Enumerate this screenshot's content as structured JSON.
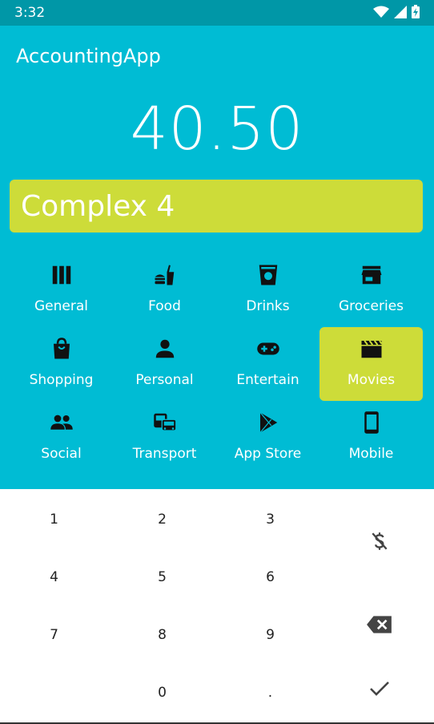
{
  "status": {
    "time": "3:32"
  },
  "app": {
    "title": "AccountingApp"
  },
  "amount": "40.50",
  "description": "Complex 4",
  "categories": [
    {
      "label": "General",
      "icon": "columns-icon",
      "selected": false
    },
    {
      "label": "Food",
      "icon": "fastfood-icon",
      "selected": false
    },
    {
      "label": "Drinks",
      "icon": "drink-cup-icon",
      "selected": false
    },
    {
      "label": "Groceries",
      "icon": "store-icon",
      "selected": false
    },
    {
      "label": "Shopping",
      "icon": "shopping-bag-icon",
      "selected": false
    },
    {
      "label": "Personal",
      "icon": "person-icon",
      "selected": false
    },
    {
      "label": "Entertain",
      "icon": "gamepad-icon",
      "selected": false
    },
    {
      "label": "Movies",
      "icon": "clapperboard-icon",
      "selected": true
    },
    {
      "label": "Social",
      "icon": "people-icon",
      "selected": false
    },
    {
      "label": "Transport",
      "icon": "transport-icon",
      "selected": false
    },
    {
      "label": "App Store",
      "icon": "play-store-icon",
      "selected": false
    },
    {
      "label": "Mobile",
      "icon": "smartphone-icon",
      "selected": false
    }
  ],
  "keypad": {
    "keys": [
      "1",
      "2",
      "3",
      "4",
      "5",
      "6",
      "7",
      "8",
      "9",
      "",
      "0",
      "."
    ]
  },
  "colors": {
    "status_bar": "#0097a7",
    "primary": "#00bcd4",
    "accent": "#cddc39"
  }
}
